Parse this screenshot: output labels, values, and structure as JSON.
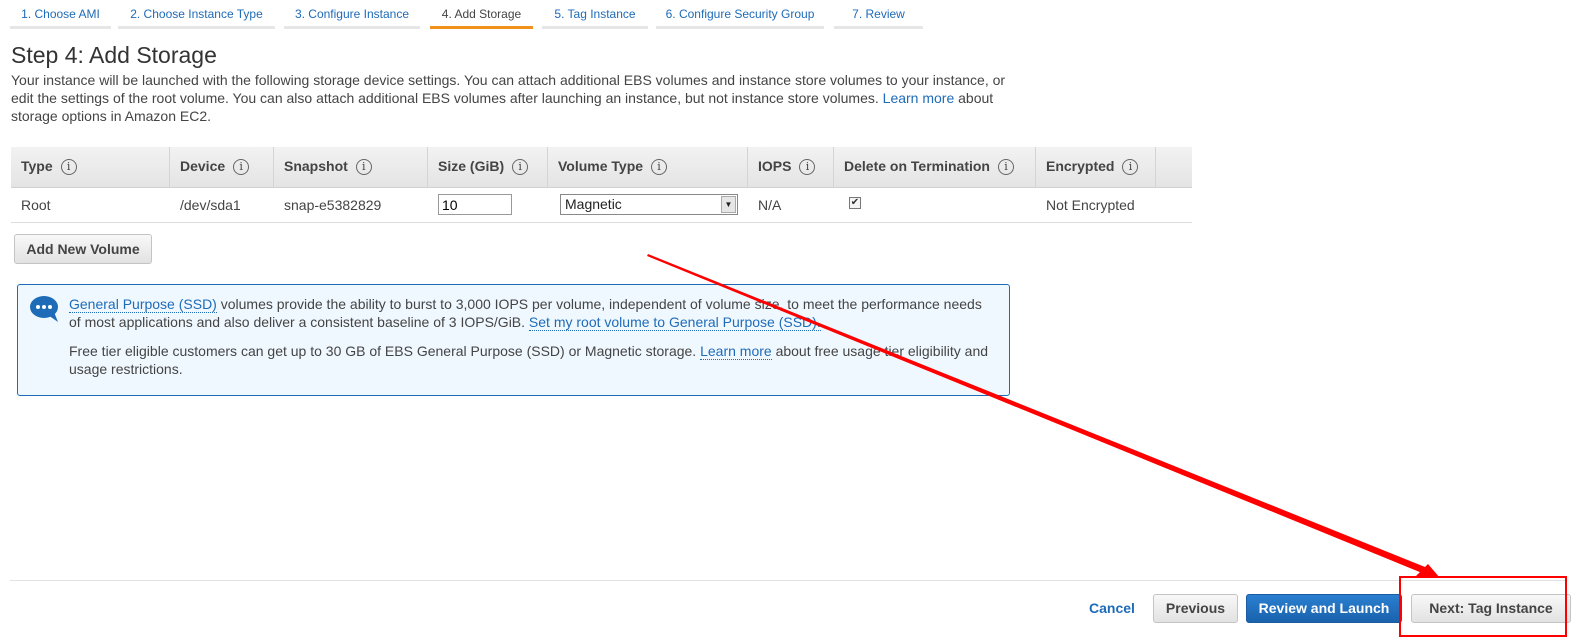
{
  "wizard_tabs": [
    {
      "label": "1. Choose AMI",
      "active": false
    },
    {
      "label": "2. Choose Instance Type",
      "active": false
    },
    {
      "label": "3. Configure Instance",
      "active": false
    },
    {
      "label": "4. Add Storage",
      "active": true
    },
    {
      "label": "5. Tag Instance",
      "active": false
    },
    {
      "label": "6. Configure Security Group",
      "active": false
    },
    {
      "label": "7. Review",
      "active": false
    }
  ],
  "page": {
    "title": "Step 4: Add Storage",
    "description_before": "Your instance will be launched with the following storage device settings. You can attach additional EBS volumes and instance store volumes to your instance, or edit the settings of the root volume. You can also attach additional EBS volumes after launching an instance, but not instance store volumes. ",
    "learn_more": "Learn more",
    "description_after": " about storage options in Amazon EC2."
  },
  "table": {
    "columns": [
      "Type",
      "Device",
      "Snapshot",
      "Size (GiB)",
      "Volume Type",
      "IOPS",
      "Delete on Termination",
      "Encrypted"
    ],
    "info_icon": "i",
    "rows": [
      {
        "type": "Root",
        "device": "/dev/sda1",
        "snapshot": "snap-e5382829",
        "size": "10",
        "volume_type": "Magnetic",
        "iops": "N/A",
        "delete_on_termination": true,
        "encrypted": "Not Encrypted"
      }
    ]
  },
  "add_volume_label": "Add New Volume",
  "callout": {
    "icon": "chat-bubble-icon",
    "link1": "General Purpose (SSD)",
    "text1": " volumes provide the ability to burst to 3,000 IOPS per volume, independent of volume size, to meet the performance needs of most applications and also deliver a consistent baseline of 3 IOPS/GiB. ",
    "link2": "Set my root volume to General Purpose (SSD).",
    "text2": "Free tier eligible customers can get up to 30 GB of EBS General Purpose (SSD) or Magnetic storage. ",
    "link3": "Learn more",
    "text3": " about free usage tier eligibility and usage restrictions."
  },
  "footer": {
    "cancel": "Cancel",
    "previous": "Previous",
    "review_launch": "Review and Launch",
    "next": "Next: Tag Instance"
  },
  "colors": {
    "link": "#1e6bb8",
    "active_tab": "#f0911c",
    "primary_button": "#1e6bb8",
    "annotation": "#ff0000"
  }
}
